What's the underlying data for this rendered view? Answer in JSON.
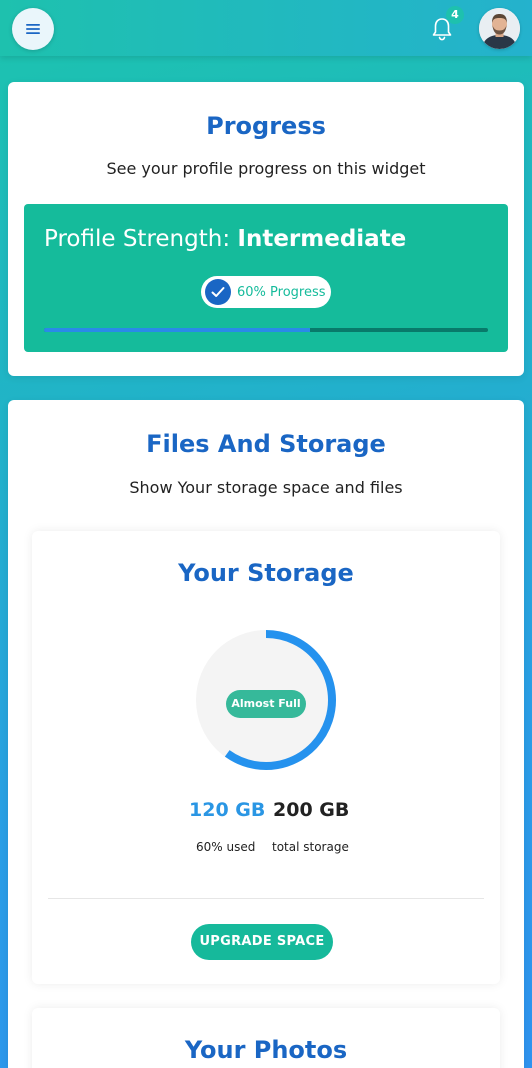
{
  "header": {
    "menu_icon": "hamburger-menu-icon",
    "bell_icon": "bell-icon",
    "notification_count": "4",
    "avatar": "user-avatar"
  },
  "progress_card": {
    "title": "Progress",
    "subtitle": "See your profile progress on this widget",
    "strength_label": "Profile Strength:",
    "strength_value": "Intermediate",
    "pill_text": "60% Progress",
    "progress_fraction": 0.6,
    "colors": {
      "box": "#15bb9b",
      "fill": "#2a8ae8",
      "track": "#087a6a"
    }
  },
  "files_card": {
    "title": "Files And Storage",
    "subtitle": "Show Your storage space and files",
    "storage": {
      "title": "Your Storage",
      "badge": "Almost Full",
      "used_value": "120 GB",
      "used_label": "60% used",
      "total_value": "200 GB",
      "total_label": "total storage",
      "used_fraction": 0.6,
      "button_label": "UPGRADE SPACE"
    },
    "photos": {
      "title": "Your Photos"
    }
  }
}
